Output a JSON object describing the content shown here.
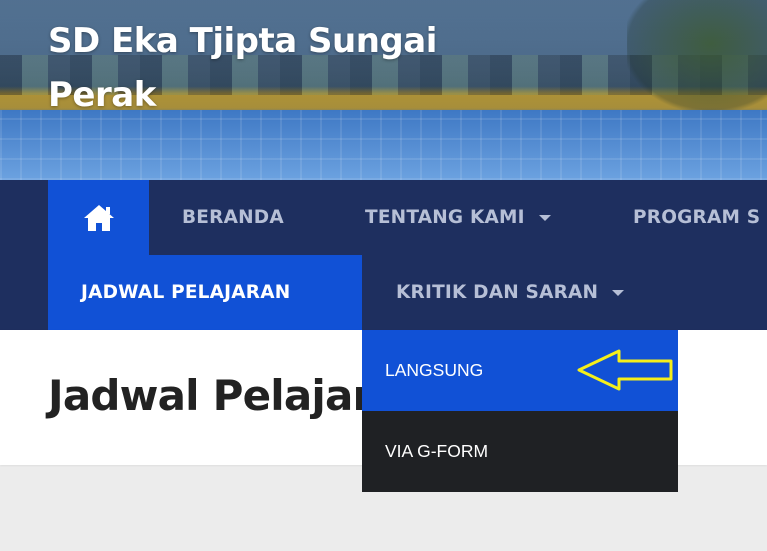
{
  "site": {
    "title": "SD Eka Tjipta Sungai Perak"
  },
  "nav": {
    "home_icon": "home-icon",
    "row1": [
      {
        "label": "BERANDA",
        "has_caret": false
      },
      {
        "label": "TENTANG KAMI",
        "has_caret": true
      },
      {
        "label": "PROGRAM S",
        "has_caret": false
      }
    ],
    "row2": [
      {
        "label": "JADWAL PELAJARAN",
        "active": true
      },
      {
        "label": "KRITIK DAN SARAN",
        "has_caret": true
      }
    ]
  },
  "dropdown": {
    "items": [
      {
        "label": "LANGSUNG",
        "highlighted": true
      },
      {
        "label": "VIA G-FORM",
        "highlighted": false
      }
    ]
  },
  "page": {
    "title": "Jadwal Pelajaran"
  },
  "annotation": {
    "icon": "yellow-arrow-icon",
    "color": "#f5ef1a"
  },
  "colors": {
    "nav_bg": "#1e2f5f",
    "active_blue": "#1151d6",
    "dropdown_dark": "#1f2124"
  }
}
